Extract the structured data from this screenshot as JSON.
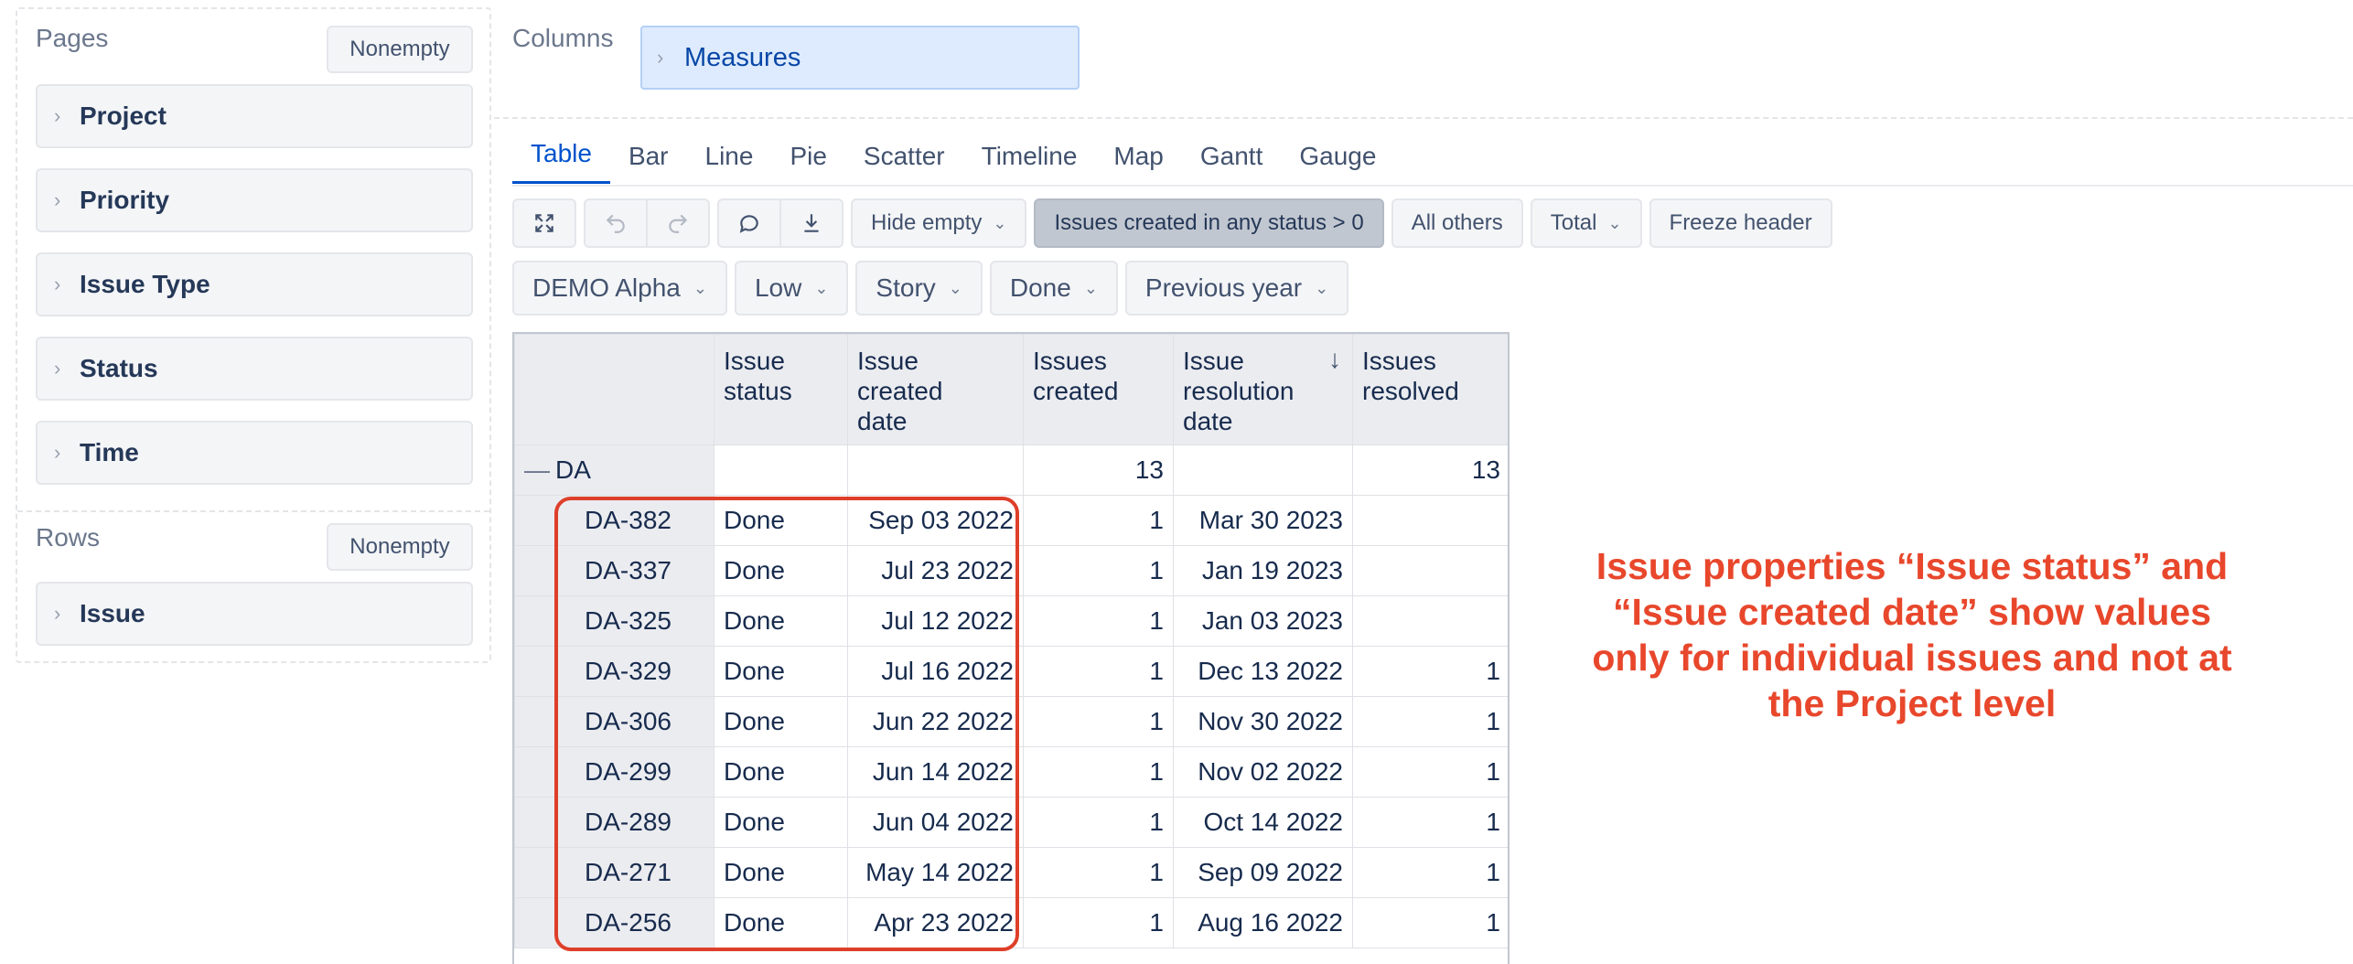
{
  "pages": {
    "title": "Pages",
    "nonempty_label": "Nonempty",
    "items": [
      "Project",
      "Priority",
      "Issue Type",
      "Status",
      "Time"
    ]
  },
  "rows": {
    "title": "Rows",
    "nonempty_label": "Nonempty",
    "items": [
      "Issue"
    ]
  },
  "columns": {
    "title": "Columns",
    "measures_label": "Measures"
  },
  "tabs": [
    "Table",
    "Bar",
    "Line",
    "Pie",
    "Scatter",
    "Timeline",
    "Map",
    "Gantt",
    "Gauge"
  ],
  "active_tab": "Table",
  "toolbar": {
    "hide_empty": "Hide empty",
    "filter_condition": "Issues created in any status > 0",
    "all_others": "All others",
    "total": "Total",
    "freeze_header": "Freeze header"
  },
  "filters": [
    "DEMO Alpha",
    "Low",
    "Story",
    "Done",
    "Previous year"
  ],
  "table": {
    "headers": [
      "Issue\nstatus",
      "Issue\ncreated\ndate",
      "Issues\ncreated",
      "Issue\nresolution\ndate",
      "Issues\nresolved"
    ],
    "sorted_column": "Issue resolution date",
    "group": {
      "label": "DA",
      "collapse": "—",
      "issues_created": "13",
      "issues_resolved": "13"
    },
    "rows": [
      {
        "id": "DA-382",
        "status": "Done",
        "created": "Sep 03 2022",
        "issues_created": "1",
        "resolution": "Mar 30 2023",
        "resolved": ""
      },
      {
        "id": "DA-337",
        "status": "Done",
        "created": "Jul 23 2022",
        "issues_created": "1",
        "resolution": "Jan 19 2023",
        "resolved": ""
      },
      {
        "id": "DA-325",
        "status": "Done",
        "created": "Jul 12 2022",
        "issues_created": "1",
        "resolution": "Jan 03 2023",
        "resolved": ""
      },
      {
        "id": "DA-329",
        "status": "Done",
        "created": "Jul 16 2022",
        "issues_created": "1",
        "resolution": "Dec 13 2022",
        "resolved": "1"
      },
      {
        "id": "DA-306",
        "status": "Done",
        "created": "Jun 22 2022",
        "issues_created": "1",
        "resolution": "Nov 30 2022",
        "resolved": "1"
      },
      {
        "id": "DA-299",
        "status": "Done",
        "created": "Jun 14 2022",
        "issues_created": "1",
        "resolution": "Nov 02 2022",
        "resolved": "1"
      },
      {
        "id": "DA-289",
        "status": "Done",
        "created": "Jun 04 2022",
        "issues_created": "1",
        "resolution": "Oct 14 2022",
        "resolved": "1"
      },
      {
        "id": "DA-271",
        "status": "Done",
        "created": "May 14 2022",
        "issues_created": "1",
        "resolution": "Sep 09 2022",
        "resolved": "1"
      },
      {
        "id": "DA-256",
        "status": "Done",
        "created": "Apr 23 2022",
        "issues_created": "1",
        "resolution": "Aug 16 2022",
        "resolved": "1"
      }
    ]
  },
  "annotation": "Issue properties “Issue status” and “Issue created date” show values only for individual issues and not at the Project level",
  "colors": {
    "accent": "#0052cc",
    "annotation": "#e8472c",
    "measures_chip": "#deebff"
  }
}
